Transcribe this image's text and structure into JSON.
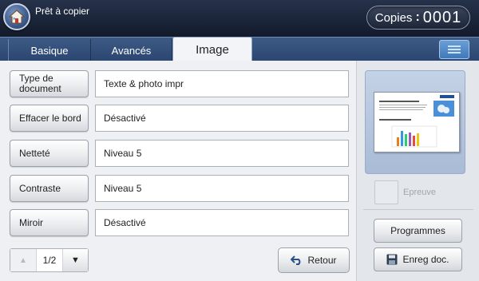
{
  "header": {
    "title": "Prêt à copier",
    "copies_label": "Copies",
    "copies_value": "0001"
  },
  "tabs": {
    "basique": "Basique",
    "avances": "Avancés",
    "image": "Image"
  },
  "options": [
    {
      "button": "Type de document",
      "value": "Texte & photo impr"
    },
    {
      "button": "Effacer le bord",
      "value": "Désactivé"
    },
    {
      "button": "Netteté",
      "value": "Niveau 5"
    },
    {
      "button": "Contraste",
      "value": "Niveau 5"
    },
    {
      "button": "Miroir",
      "value": "Désactivé"
    }
  ],
  "pager": {
    "current": "1/2"
  },
  "retour_label": "Retour",
  "side": {
    "epreuve_label": "Epreuve",
    "programmes_label": "Programmes",
    "enreg_label": "Enreg doc."
  },
  "icons": {
    "home": "home-icon",
    "menu": "menu-icon",
    "up": "arrow-up-icon",
    "down": "arrow-down-icon",
    "back": "back-arrow-icon",
    "save": "floppy-disk-icon"
  },
  "colors": {
    "header_bg": "#1a2438",
    "tabbar_bg": "#2b4670",
    "accent": "#3f79bb"
  }
}
